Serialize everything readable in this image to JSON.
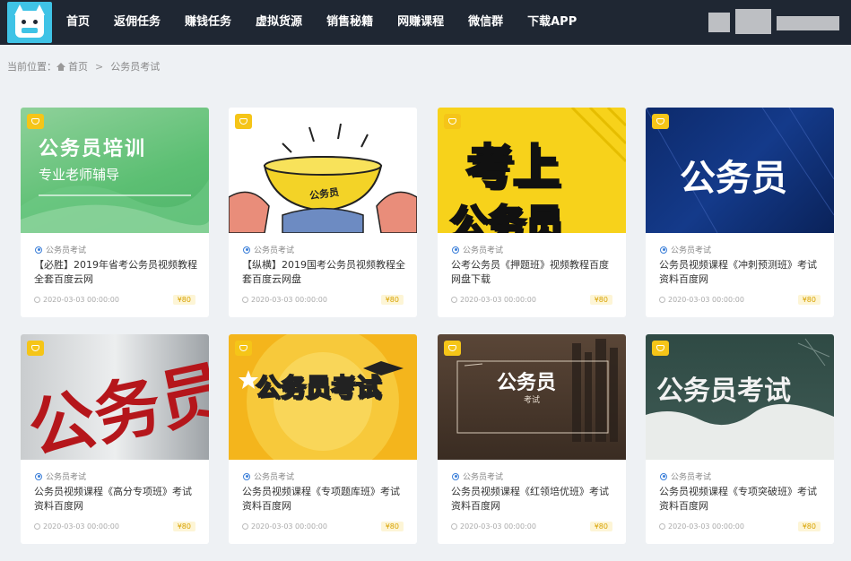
{
  "nav": {
    "items": [
      "首页",
      "返佣任务",
      "赚钱任务",
      "虚拟货源",
      "销售秘籍",
      "网赚课程",
      "微信群",
      "下载APP"
    ]
  },
  "breadcrumb": {
    "label": "当前位置：",
    "home": "首页",
    "separator": ">",
    "current": "公务员考试"
  },
  "cards": [
    {
      "category": "公务员考试",
      "title": "【必胜】2019年省考公务员视频教程全套百度云网",
      "date": "2020-03-03 00:00:00",
      "price": "¥80",
      "img_line1": "公务员培训",
      "img_line2": "专业老师辅导"
    },
    {
      "category": "公务员考试",
      "title": "【纵横】2019国考公务员视频教程全套百度云网盘",
      "date": "2020-03-03 00:00:00",
      "price": "¥80",
      "img_line1": "公务员"
    },
    {
      "category": "公务员考试",
      "title": "公考公务员《押题班》视频教程百度网盘下载",
      "date": "2020-03-03 00:00:00",
      "price": "¥80",
      "img_line1": "考上",
      "img_line2": "公务员"
    },
    {
      "category": "公务员考试",
      "title": "公务员视频课程《冲刺预测班》考试资料百度网",
      "date": "2020-03-03 00:00:00",
      "price": "¥80",
      "img_line1": "公务员"
    },
    {
      "category": "公务员考试",
      "title": "公务员视频课程《高分专项班》考试资料百度网",
      "date": "2020-03-03 00:00:00",
      "price": "¥80",
      "img_line1": "公务员之"
    },
    {
      "category": "公务员考试",
      "title": "公务员视频课程《专项题库班》考试资料百度网",
      "date": "2020-03-03 00:00:00",
      "price": "¥80",
      "img_line1": "公务员考试"
    },
    {
      "category": "公务员考试",
      "title": "公务员视频课程《红领培优班》考试资料百度网",
      "date": "2020-03-03 00:00:00",
      "price": "¥80",
      "img_line1": "公务员",
      "img_line2": "考试"
    },
    {
      "category": "公务员考试",
      "title": "公务员视频课程《专项突破班》考试资料百度网",
      "date": "2020-03-03 00:00:00",
      "price": "¥80",
      "img_line1": "公务员考试"
    }
  ],
  "colors": {
    "topbar": "#1f2733",
    "accent": "#f5c518",
    "logo": "#3fc3e6"
  }
}
